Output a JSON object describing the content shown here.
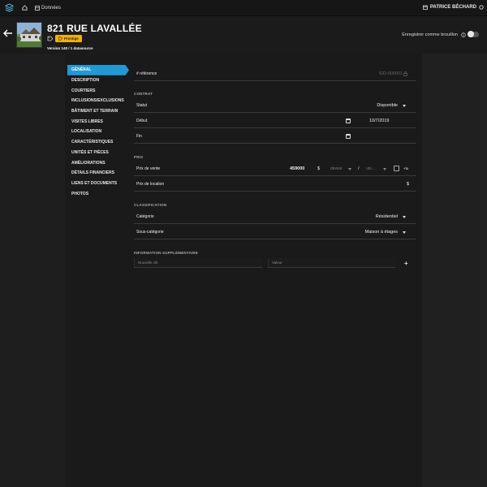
{
  "topbar": {
    "nav_label": "Données",
    "user_name": "PATRICE BÉCHARD",
    "icons": [
      "logo-icon",
      "home-icon",
      "data-icon",
      "calendar-icon",
      "settings-icon"
    ]
  },
  "header": {
    "title": "821 RUE LAVALLÉE",
    "badge": "Prestige",
    "version": "Version 140 / 1 datasource",
    "draft_label": "Enregistrer comme brouillon",
    "draft_enabled": false
  },
  "sidenav": {
    "items": [
      {
        "label": "Général",
        "active": true
      },
      {
        "label": "Description",
        "active": false
      },
      {
        "label": "Courtiers",
        "active": false
      },
      {
        "label": "Inclusions/Exclusions",
        "active": false
      },
      {
        "label": "Bâtiment et terrain",
        "active": false
      },
      {
        "label": "Visites libres",
        "active": false
      },
      {
        "label": "Localisation",
        "active": false
      },
      {
        "label": "Caractéristiques",
        "active": false
      },
      {
        "label": "Unités et pièces",
        "active": false
      },
      {
        "label": "Améliorations",
        "active": false
      },
      {
        "label": "Détails financiers",
        "active": false
      },
      {
        "label": "Liens et documents",
        "active": false
      },
      {
        "label": "Photos",
        "active": false
      }
    ]
  },
  "form": {
    "reference": {
      "label": "# référence",
      "value": "SID-000001"
    },
    "contract": {
      "section": "Contrat",
      "status_label": "Statut",
      "status_value": "Disponible",
      "start_label": "Début",
      "start_value": "10/7/2019",
      "end_label": "Fin",
      "end_value": ""
    },
    "price": {
      "section": "Prix",
      "sale_label": "Prix de vente",
      "sale_value": "459000",
      "currency_symbol": "$",
      "currency_placeholder": "devise",
      "slash": "/",
      "unit_placeholder": "uni...",
      "tax_label": "+tx",
      "rent_label": "Prix de location",
      "rent_currency": "$"
    },
    "classification": {
      "section": "Classification",
      "category_label": "Catégorie",
      "category_value": "Résidentiel",
      "subcategory_label": "Sous-catégorie",
      "subcategory_value": "Maison à étages"
    },
    "extra": {
      "section": "Information supplémentaire",
      "key_placeholder": "Nouvelle clé",
      "value_placeholder": "Valeur",
      "add_label": "+"
    }
  }
}
